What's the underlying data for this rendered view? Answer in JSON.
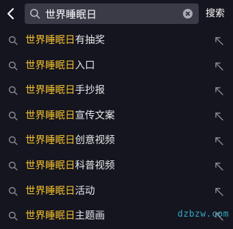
{
  "search": {
    "value": "世界睡眠日",
    "submit_label": "搜索"
  },
  "keyword": "世界睡眠日",
  "suggestions": [
    {
      "highlight": "世界睡眠日",
      "rest": "有抽奖"
    },
    {
      "highlight": "世界睡眠日",
      "rest": "入口"
    },
    {
      "highlight": "世界睡眠日",
      "rest": "手抄报"
    },
    {
      "highlight": "世界睡眠日",
      "rest": "宣传文案"
    },
    {
      "highlight": "世界睡眠日",
      "rest": "创意视频"
    },
    {
      "highlight": "世界睡眠日",
      "rest": "科普视频"
    },
    {
      "highlight": "世界睡眠日",
      "rest": "活动"
    },
    {
      "highlight": "世界睡眠日",
      "rest": "主题画"
    }
  ],
  "watermark": "dzbzw.com",
  "colors": {
    "background": "#15151f",
    "search_box": "#3a3b47",
    "highlight": "#f2c12e",
    "text": "#e8e8ec",
    "icon": "#8d8e98"
  }
}
